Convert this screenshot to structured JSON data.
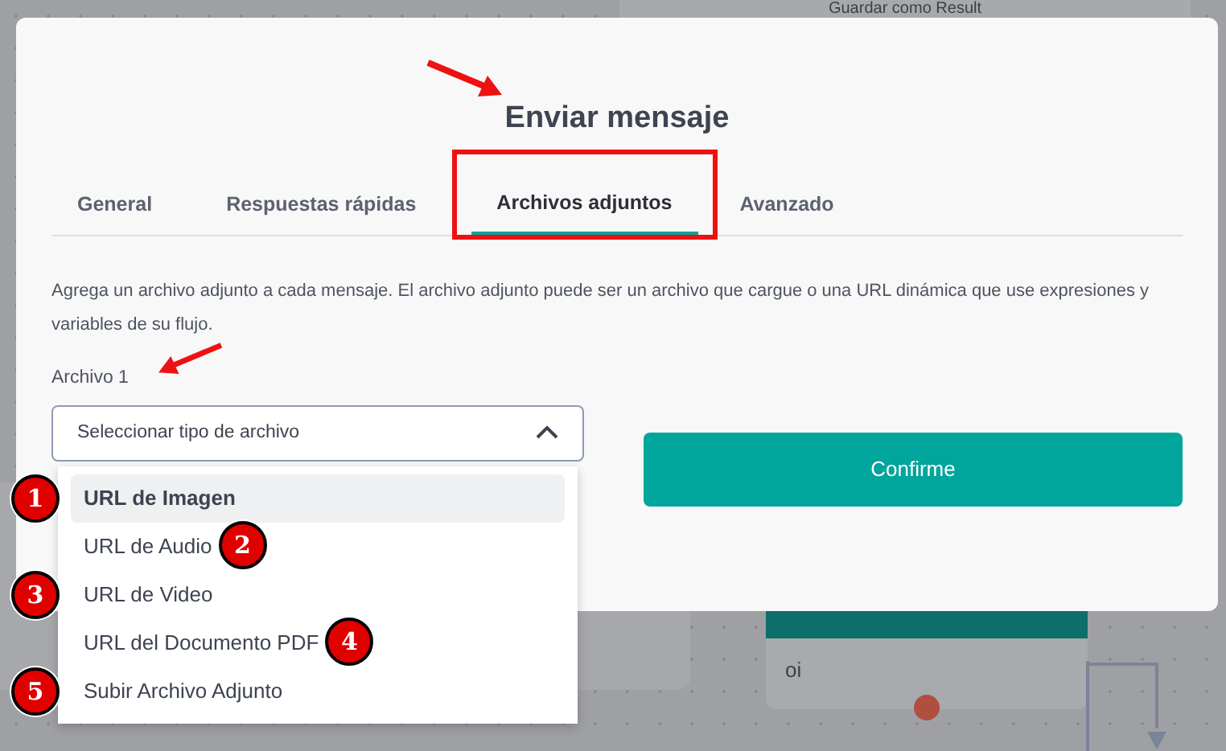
{
  "background": {
    "top_card_text": "Guardar como Result",
    "node_text": "oi"
  },
  "dialog": {
    "title": "Enviar mensaje",
    "tabs": [
      {
        "label": "General",
        "selected": false,
        "highlighted": false
      },
      {
        "label": "Respuestas rápidas",
        "selected": false,
        "highlighted": false
      },
      {
        "label": "Archivos adjuntos",
        "selected": true,
        "highlighted": true
      },
      {
        "label": "Avanzado",
        "selected": false,
        "highlighted": false
      }
    ],
    "description": "Agrega un archivo adjunto a cada mensaje. El archivo adjunto puede ser un archivo que cargue o una URL dinámica que use expresiones y variables de su flujo.",
    "field_label": "Archivo 1",
    "select": {
      "placeholder": "Seleccionar tipo de archivo",
      "expanded": true
    },
    "options": [
      {
        "label": "URL de Imagen",
        "selected": true,
        "marker": "1",
        "marker_after": false
      },
      {
        "label": "URL de Audio",
        "selected": false,
        "marker": "2",
        "marker_after": true
      },
      {
        "label": "URL de Video",
        "selected": false,
        "marker": "3",
        "marker_after": false
      },
      {
        "label": "URL del Documento PDF",
        "selected": false,
        "marker": "4",
        "marker_after": true
      },
      {
        "label": "Subir Archivo Adjunto",
        "selected": false,
        "marker": "5",
        "marker_after": false
      }
    ],
    "confirm_button": "Confirme"
  }
}
